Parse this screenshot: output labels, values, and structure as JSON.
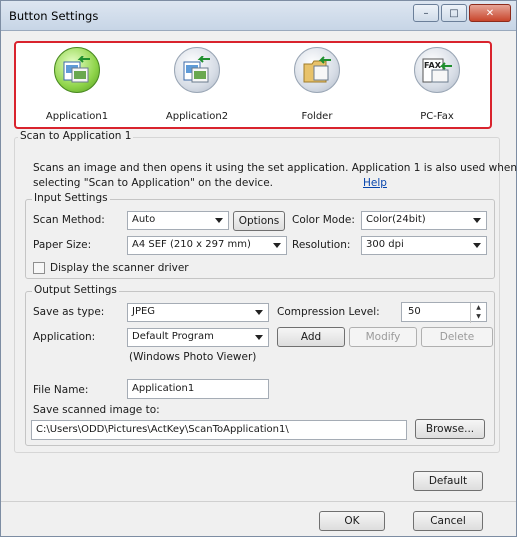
{
  "window": {
    "title": "Button Settings"
  },
  "apps": [
    {
      "label": "Application1",
      "icon": "scan-to-application-icon",
      "selected": true
    },
    {
      "label": "Application2",
      "icon": "scan-to-application-icon",
      "selected": false
    },
    {
      "label": "Folder",
      "icon": "scan-to-folder-icon",
      "selected": false
    },
    {
      "label": "PC-Fax",
      "icon": "scan-to-fax-icon",
      "selected": false,
      "icon_text": "FAX"
    }
  ],
  "scan_section": {
    "title": "Scan to Application 1",
    "description_line1": "Scans an image and then opens it using the set application. Application 1 is also used when",
    "description_line2": "selecting \"Scan to Application\" on the device.",
    "help_link": "Help"
  },
  "input_settings": {
    "title": "Input Settings",
    "scan_method_label": "Scan Method:",
    "scan_method_value": "Auto",
    "options_button": "Options",
    "color_mode_label": "Color Mode:",
    "color_mode_value": "Color(24bit)",
    "paper_size_label": "Paper Size:",
    "paper_size_value": "A4 SEF (210 x 297 mm)",
    "resolution_label": "Resolution:",
    "resolution_value": "300 dpi",
    "display_driver_label": "Display the scanner driver"
  },
  "output_settings": {
    "title": "Output Settings",
    "save_as_type_label": "Save as type:",
    "save_as_type_value": "JPEG",
    "compression_label": "Compression Level:",
    "compression_value": "50",
    "application_label": "Application:",
    "application_value": "Default Program",
    "application_note": "(Windows Photo Viewer)",
    "add_button": "Add",
    "modify_button": "Modify",
    "delete_button": "Delete",
    "file_name_label": "File Name:",
    "file_name_value": "Application1",
    "save_path_label": "Save scanned image to:",
    "save_path_value": "C:\\Users\\ODD\\Pictures\\ActKey\\ScanToApplication1\\",
    "browse_button": "Browse..."
  },
  "footer": {
    "default_button": "Default",
    "ok_button": "OK",
    "cancel_button": "Cancel"
  },
  "colors": {
    "highlight_border": "#d9232d",
    "link": "#0645ad"
  }
}
